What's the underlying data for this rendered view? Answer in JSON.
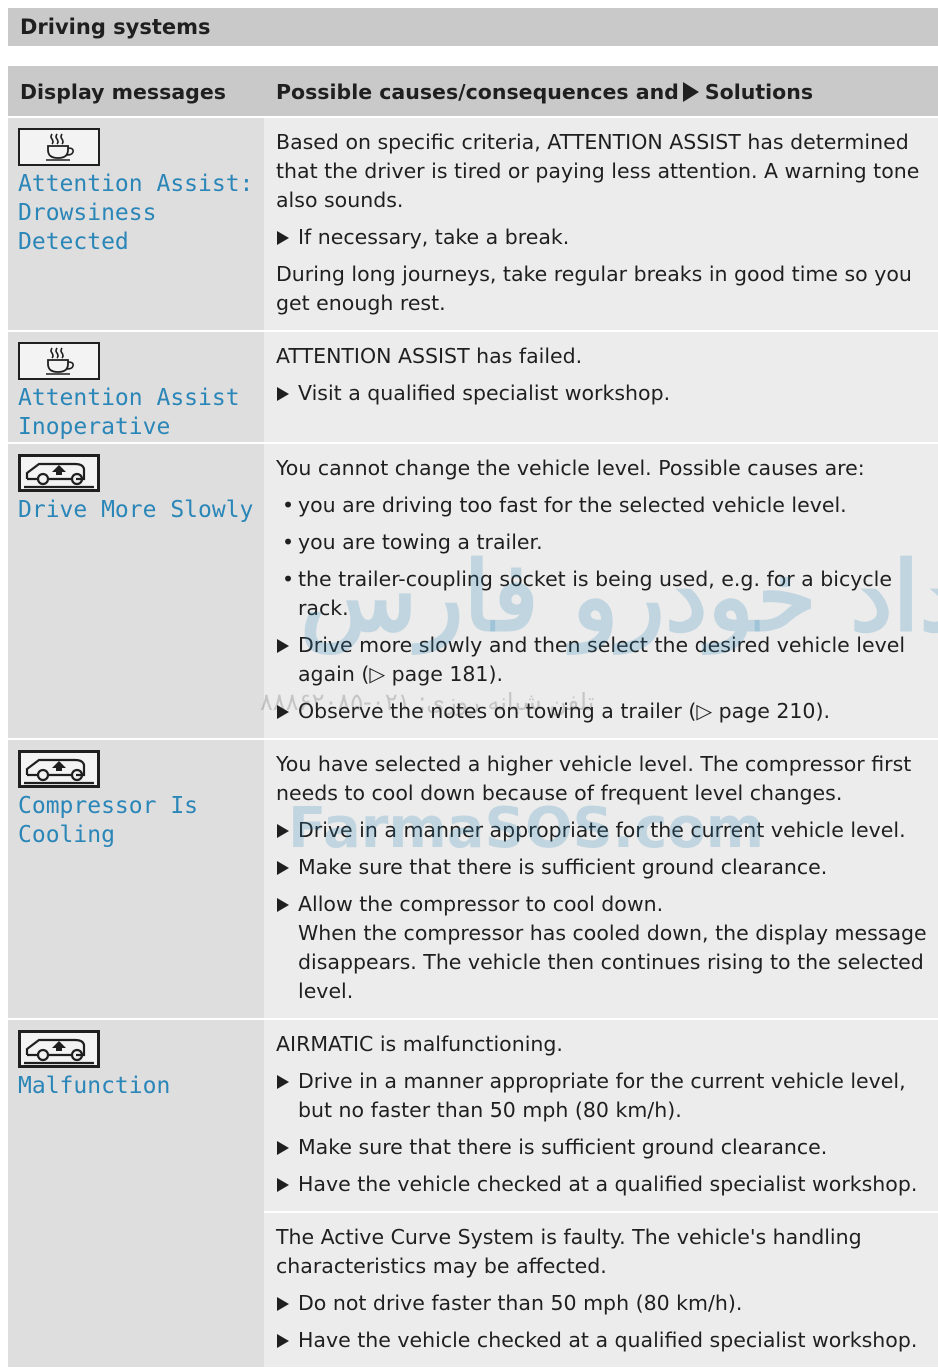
{
  "section_title": "Driving systems",
  "table_header": {
    "col1": "Display messages",
    "col2_prefix": "Possible causes/consequences and",
    "col2_suffix": "Solutions"
  },
  "rows": [
    {
      "icon": "coffee-cup-icon",
      "message": "Attention Assist:\nDrowsiness\nDetected",
      "blocks": [
        {
          "items": [
            {
              "kind": "text",
              "text": "Based on specific criteria, ATTENTION ASSIST has determined that the driver is tired or paying less attention. A warning tone also sounds."
            },
            {
              "kind": "step",
              "text": "If necessary, take a break."
            },
            {
              "kind": "text",
              "text": "During long journeys, take regular breaks in good time so you get enough rest."
            }
          ]
        }
      ]
    },
    {
      "icon": "coffee-cup-icon",
      "message": "Attention Assist\nInoperative",
      "blocks": [
        {
          "items": [
            {
              "kind": "text",
              "text": "ATTENTION ASSIST has failed."
            },
            {
              "kind": "step",
              "text": "Visit a qualified specialist workshop."
            }
          ]
        }
      ]
    },
    {
      "icon": "vehicle-level-icon",
      "message": "Drive More Slowly",
      "blocks": [
        {
          "items": [
            {
              "kind": "text",
              "text": "You cannot change the vehicle level. Possible causes are:"
            },
            {
              "kind": "bullet",
              "text": "you are driving too fast for the selected vehicle level."
            },
            {
              "kind": "bullet",
              "text": "you are towing a trailer."
            },
            {
              "kind": "bullet",
              "text": "the trailer-coupling socket is being used, e.g. for a bicycle rack."
            },
            {
              "kind": "step",
              "text": "Drive more slowly and then select the desired vehicle level again (▷ page 181)."
            },
            {
              "kind": "step",
              "text": "Observe the notes on towing a trailer (▷ page 210)."
            }
          ]
        }
      ]
    },
    {
      "icon": "vehicle-level-icon",
      "message": "Compressor Is\nCooling",
      "blocks": [
        {
          "items": [
            {
              "kind": "text",
              "text": "You have selected a higher vehicle level. The compressor first needs to cool down because of frequent level changes."
            },
            {
              "kind": "step",
              "text": "Drive in a manner appropriate for the current vehicle level."
            },
            {
              "kind": "step",
              "text": "Make sure that there is sufficient ground clearance."
            },
            {
              "kind": "step",
              "text": "Allow the compressor to cool down.\nWhen the compressor has cooled down, the display message disappears. The vehicle then continues rising to the selected level."
            }
          ]
        }
      ]
    },
    {
      "icon": "vehicle-level-icon",
      "message": "Malfunction",
      "blocks": [
        {
          "items": [
            {
              "kind": "text",
              "text": "AIRMATIC is malfunctioning."
            },
            {
              "kind": "step",
              "text": "Drive in a manner appropriate for the current vehicle level, but no faster than 50 mph (80 km/h)."
            },
            {
              "kind": "step",
              "text": "Make sure that there is sufficient ground clearance."
            },
            {
              "kind": "step",
              "text": "Have the vehicle checked at a qualified specialist workshop."
            }
          ]
        },
        {
          "items": [
            {
              "kind": "text",
              "text": "The Active Curve System is faulty. The vehicle's handling characteristics may be affected."
            },
            {
              "kind": "step",
              "text": "Do not drive faster than 50 mph (80 km/h)."
            },
            {
              "kind": "step",
              "text": "Have the vehicle checked at a qualified specialist workshop."
            }
          ]
        }
      ]
    }
  ],
  "watermark": {
    "brand_fa": "امداد خودرو فارس",
    "phone_line": "تلفن شبانه روزی: ۰۲۱-۸۸۸۶۲۰۸۵",
    "url": "FarmaSOS.com"
  },
  "colors": {
    "message_text": "#2b86b8",
    "header_bg": "#c9c9c9",
    "left_bg": "#dedede",
    "right_bg": "#ececec"
  }
}
